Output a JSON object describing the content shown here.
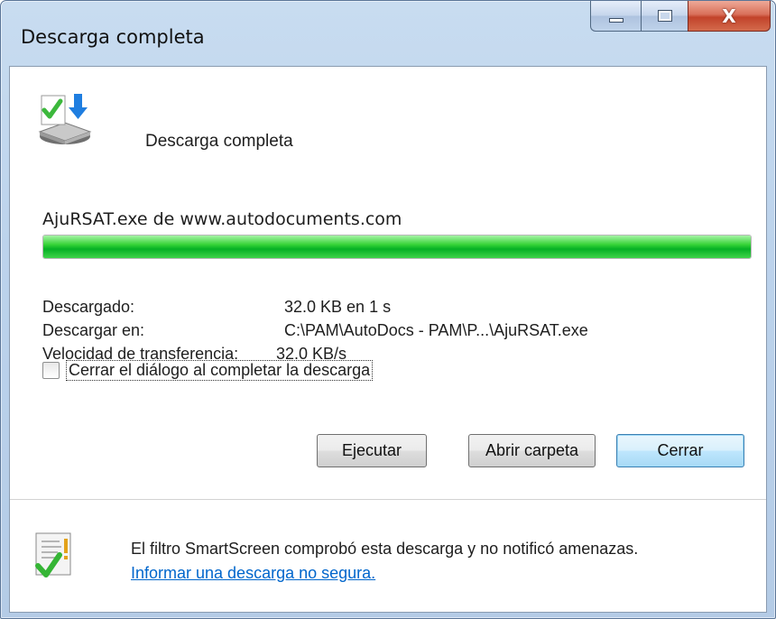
{
  "window": {
    "title": "Descarga completa",
    "close_glyph": "X"
  },
  "header": {
    "icon": "download-complete-icon",
    "text": "Descarga completa"
  },
  "download": {
    "source": "AjuRSAT.exe de www.autodocuments.com",
    "progress_percent": 100,
    "progress_color": "#06b025",
    "details": [
      {
        "label": "Descargado:",
        "value": "32.0 KB en 1 s"
      },
      {
        "label": "Descargar en:",
        "value": "C:\\PAM\\AutoDocs - PAM\\P...\\AjuRSAT.exe"
      },
      {
        "label": "Velocidad de transferencia:",
        "value": "32.0 KB/s"
      }
    ]
  },
  "options": {
    "close_on_complete_label": "Cerrar el diálogo al completar la descarga",
    "close_on_complete_checked": false
  },
  "buttons": {
    "run_label": "Ejecutar",
    "open_folder_label": "Abrir carpeta",
    "close_label": "Cerrar"
  },
  "footer": {
    "icon": "smartscreen-check-icon",
    "message": "El filtro SmartScreen comprobó esta descarga y no notificó amenazas.",
    "report_link": "Informar una descarga no segura."
  },
  "colors": {
    "link": "#0066cc",
    "titlebar": "#bcd3ec",
    "close_button": "#c2432a"
  }
}
